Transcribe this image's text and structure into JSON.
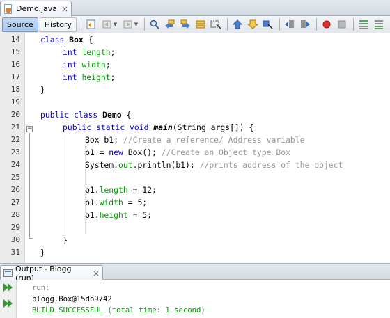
{
  "editor_tab": {
    "title": "Demo.java",
    "icon": "java-file-icon",
    "close": "×"
  },
  "toolbar": {
    "source_label": "Source",
    "history_label": "History",
    "icons": [
      "last-edit-icon",
      "back-icon",
      "forward-icon",
      "find-icon",
      "find-previous-icon",
      "find-next-icon",
      "find-selection-icon",
      "toggle-highlight-icon",
      "toggle-bookmark-icon",
      "previous-bookmark-icon",
      "next-bookmark-icon",
      "shift-left-icon",
      "shift-right-icon",
      "start-macro-icon",
      "stop-macro-icon",
      "comment-icon",
      "uncomment-icon"
    ]
  },
  "editor": {
    "line_numbers": [
      "14",
      "15",
      "16",
      "17",
      "18",
      "19",
      "20",
      "21",
      "22",
      "23",
      "24",
      "25",
      "26",
      "27",
      "28",
      "29",
      "30",
      "31"
    ],
    "lines": [
      {
        "n": "14",
        "indent": 1,
        "parts": [
          {
            "t": "class ",
            "c": "kw"
          },
          {
            "t": "Box",
            "c": "bold"
          },
          {
            "t": " {",
            "c": ""
          }
        ]
      },
      {
        "n": "15",
        "indent": 2,
        "parts": [
          {
            "t": "int ",
            "c": "kw"
          },
          {
            "t": "length",
            "c": "fd"
          },
          {
            "t": ";",
            "c": ""
          }
        ]
      },
      {
        "n": "16",
        "indent": 2,
        "parts": [
          {
            "t": "int ",
            "c": "kw"
          },
          {
            "t": "width",
            "c": "fd"
          },
          {
            "t": ";",
            "c": ""
          }
        ]
      },
      {
        "n": "17",
        "indent": 2,
        "parts": [
          {
            "t": "int ",
            "c": "kw"
          },
          {
            "t": "height",
            "c": "fd"
          },
          {
            "t": ";",
            "c": ""
          }
        ]
      },
      {
        "n": "18",
        "indent": 1,
        "parts": [
          {
            "t": "}",
            "c": ""
          }
        ]
      },
      {
        "n": "19",
        "indent": 1,
        "parts": []
      },
      {
        "n": "20",
        "indent": 1,
        "parts": [
          {
            "t": "public class ",
            "c": "kw"
          },
          {
            "t": "Demo",
            "c": "bold"
          },
          {
            "t": " {",
            "c": ""
          }
        ]
      },
      {
        "n": "21",
        "indent": 2,
        "parts": [
          {
            "t": "public static void ",
            "c": "kw"
          },
          {
            "t": "main",
            "c": "mt"
          },
          {
            "t": "(String args[]) {",
            "c": ""
          }
        ]
      },
      {
        "n": "22",
        "indent": 3,
        "parts": [
          {
            "t": "Box b1; ",
            "c": ""
          },
          {
            "t": "//Create a reference/ Address variable",
            "c": "cm"
          }
        ]
      },
      {
        "n": "23",
        "indent": 3,
        "parts": [
          {
            "t": "b1 = ",
            "c": ""
          },
          {
            "t": "new ",
            "c": "kw"
          },
          {
            "t": "Box(); ",
            "c": ""
          },
          {
            "t": "//Create an Object type Box",
            "c": "cm"
          }
        ]
      },
      {
        "n": "24",
        "indent": 3,
        "parts": [
          {
            "t": "System.",
            "c": ""
          },
          {
            "t": "out",
            "c": "fd"
          },
          {
            "t": ".println(b1); ",
            "c": ""
          },
          {
            "t": "//prints address of the object",
            "c": "cm"
          }
        ]
      },
      {
        "n": "25",
        "indent": 3,
        "parts": []
      },
      {
        "n": "26",
        "indent": 3,
        "parts": [
          {
            "t": "b1.",
            "c": ""
          },
          {
            "t": "length",
            "c": "fd"
          },
          {
            "t": " = 12;",
            "c": ""
          }
        ]
      },
      {
        "n": "27",
        "indent": 3,
        "parts": [
          {
            "t": "b1.",
            "c": ""
          },
          {
            "t": "width",
            "c": "fd"
          },
          {
            "t": " = 5;",
            "c": ""
          }
        ]
      },
      {
        "n": "28",
        "indent": 3,
        "parts": [
          {
            "t": "b1.",
            "c": ""
          },
          {
            "t": "height",
            "c": "fd"
          },
          {
            "t": " = 5;",
            "c": ""
          }
        ]
      },
      {
        "n": "29",
        "indent": 3,
        "parts": []
      },
      {
        "n": "30",
        "indent": 2,
        "parts": [
          {
            "t": "}",
            "c": ""
          }
        ]
      },
      {
        "n": "31",
        "indent": 1,
        "parts": [
          {
            "t": "}",
            "c": ""
          }
        ]
      }
    ]
  },
  "output": {
    "tab_title": "Output - Blogg (run)",
    "close": "×",
    "lines": [
      {
        "text": "run:",
        "color": "#808080"
      },
      {
        "text": "blogg.Box@15db9742",
        "color": "#000000"
      },
      {
        "text": "BUILD SUCCESSFUL (total time: 1 second)",
        "color": "#009900"
      }
    ]
  },
  "colors": {
    "keyword": "#0000e6",
    "comment": "#969696",
    "field": "#009900",
    "success": "#009900"
  }
}
